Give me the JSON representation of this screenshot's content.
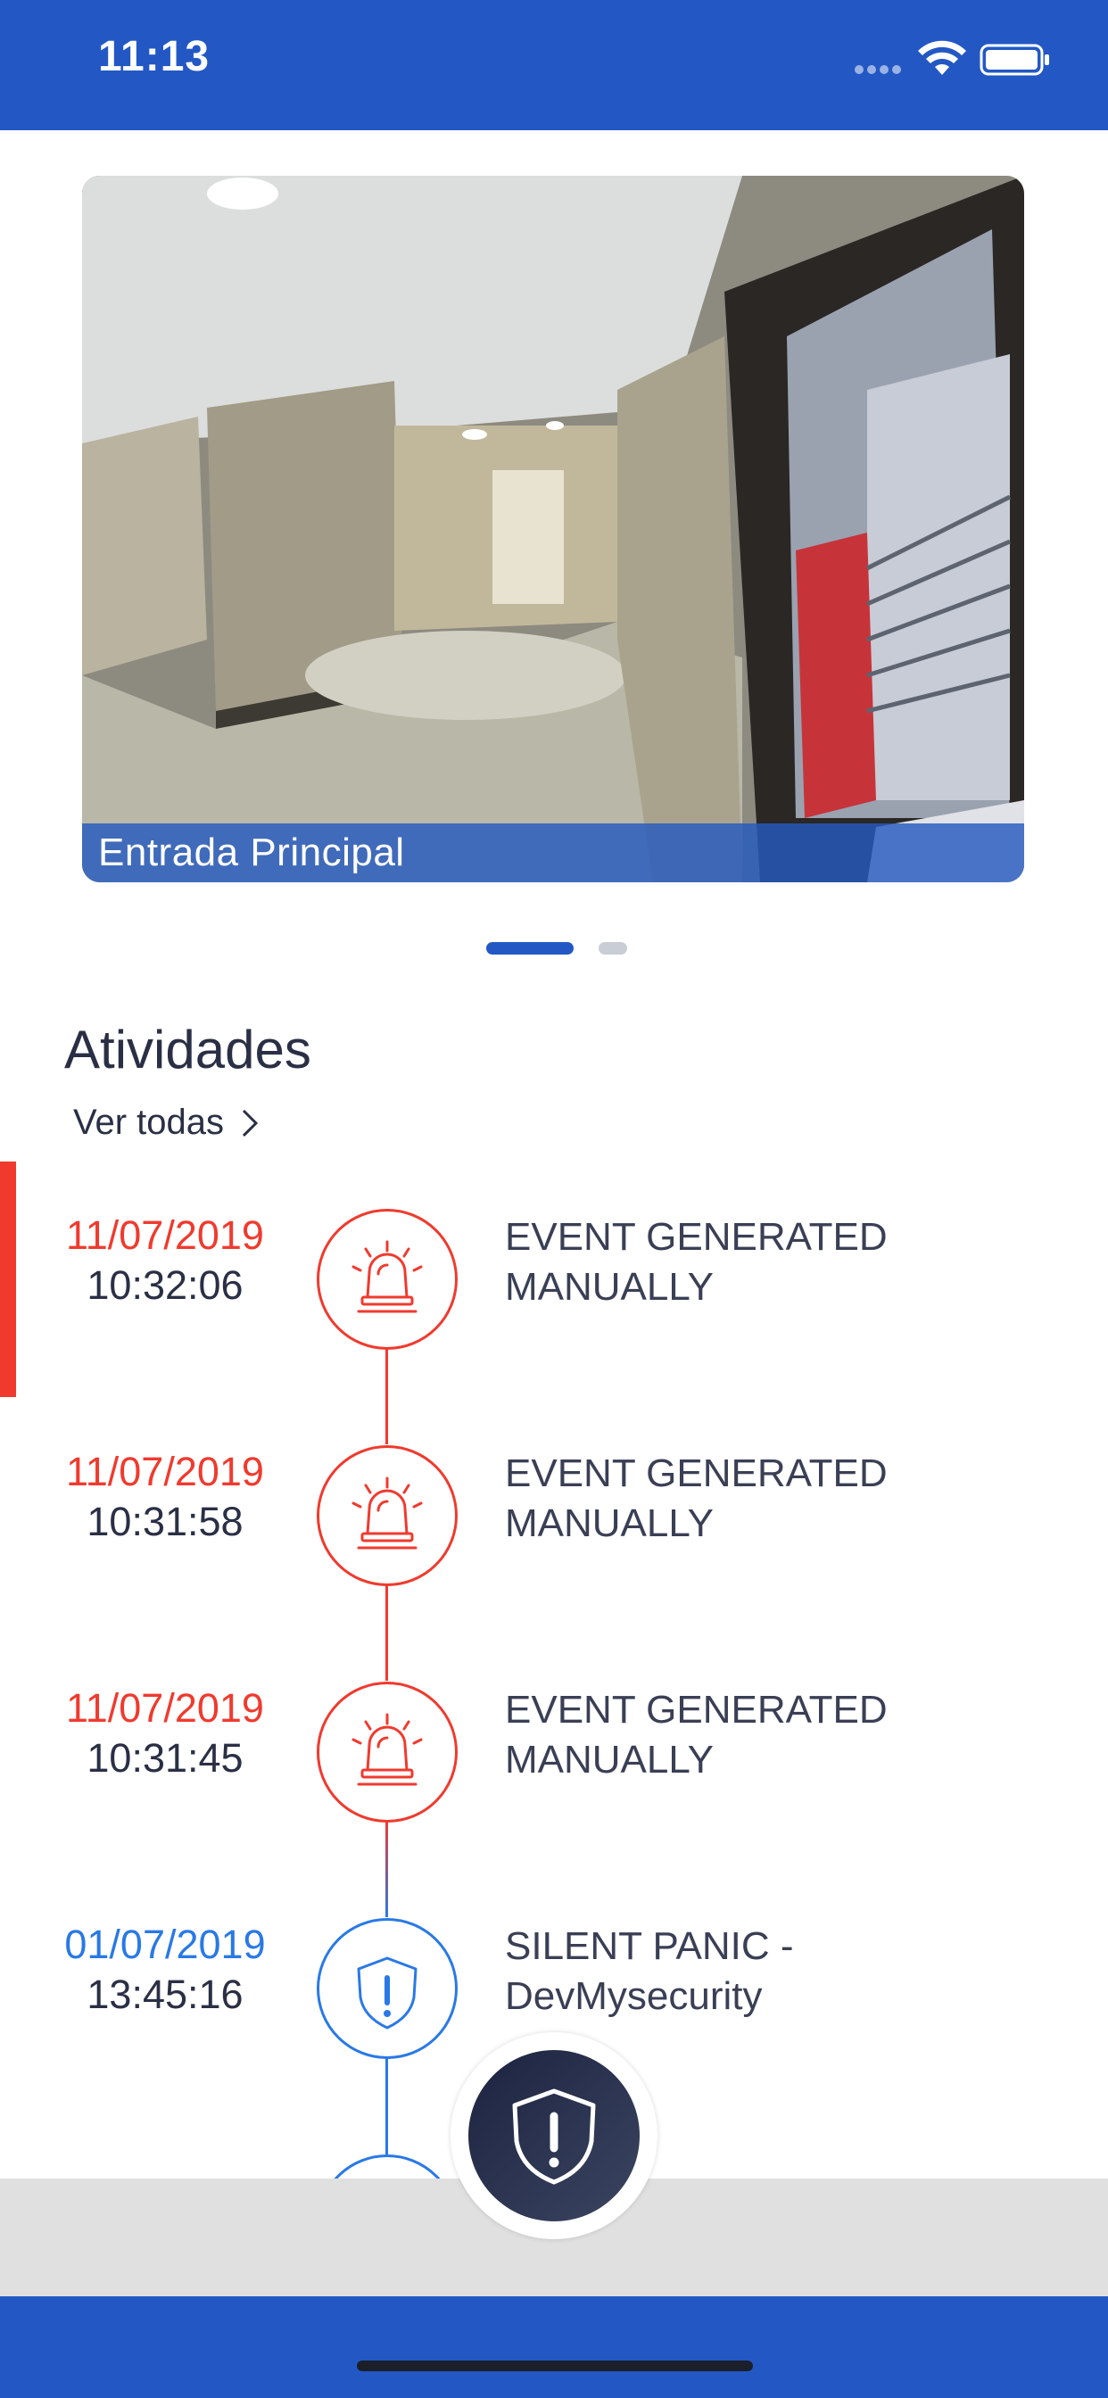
{
  "status_bar": {
    "time": "11:13"
  },
  "camera": {
    "caption": "Entrada Principal"
  },
  "pager": {
    "count": 2,
    "active_index": 0
  },
  "activities": {
    "title": "Atividades",
    "see_all": "Ver todas",
    "events": [
      {
        "date": "11/07/2019",
        "time": "10:32:06",
        "desc": "EVENT GENERATED MANUALLY",
        "type": "alarm",
        "color": "#f03a2e"
      },
      {
        "date": "11/07/2019",
        "time": "10:31:58",
        "desc": "EVENT GENERATED MANUALLY",
        "type": "alarm",
        "color": "#f03a2e"
      },
      {
        "date": "11/07/2019",
        "time": "10:31:45",
        "desc": "EVENT GENERATED MANUALLY",
        "type": "alarm",
        "color": "#f03a2e"
      },
      {
        "date": "01/07/2019",
        "time": "13:45:16",
        "desc": "SILENT PANIC  - DevMysecurity",
        "type": "panic",
        "color": "#2979e6"
      }
    ]
  },
  "icons": {
    "alarm": "siren-icon",
    "panic": "shield-alert-icon",
    "fab": "shield-alert-icon"
  },
  "colors": {
    "primary": "#2358c4",
    "alert_red": "#f03a2e",
    "info_blue": "#2979e6",
    "text_dark": "#2a2f45"
  }
}
